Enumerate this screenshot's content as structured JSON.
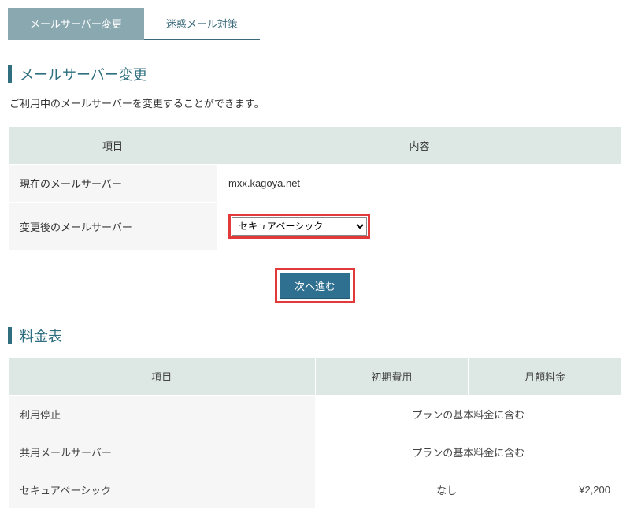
{
  "tabs": {
    "active": "メールサーバー変更",
    "inactive": "迷惑メール対策"
  },
  "section1": {
    "title": "メールサーバー変更",
    "desc": "ご利用中のメールサーバーを変更することができます。"
  },
  "config_table": {
    "head_item": "項目",
    "head_content": "内容",
    "row1_label": "現在のメールサーバー",
    "row1_value": "mxx.kagoya.net",
    "row2_label": "変更後のメールサーバー",
    "select_value": "セキュアベーシック"
  },
  "button_next": "次へ進む",
  "section2": {
    "title": "料金表"
  },
  "price_table": {
    "head_item": "項目",
    "head_initial": "初期費用",
    "head_monthly": "月額料金",
    "rows": [
      {
        "label": "利用停止",
        "merged": "プランの基本料金に含む"
      },
      {
        "label": "共用メールサーバー",
        "merged": "プランの基本料金に含む"
      },
      {
        "label": "セキュアベーシック",
        "initial": "なし",
        "monthly": "¥2,200"
      }
    ]
  }
}
